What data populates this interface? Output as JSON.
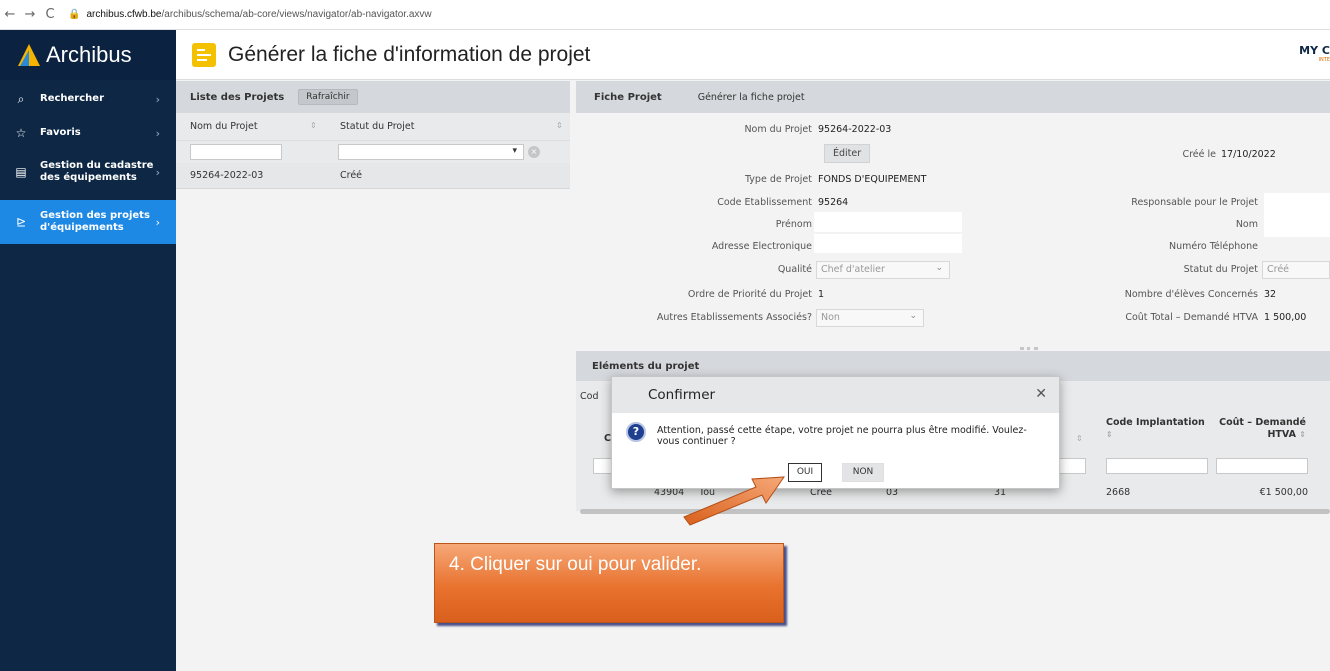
{
  "browser": {
    "back": "←",
    "forward": "→",
    "reload": "C",
    "url_host": "archibus.cfwb.be",
    "url_path": "/archibus/schema/ab-core/views/navigator/ab-navigator.axvw"
  },
  "app": {
    "logo": "Archibus"
  },
  "sidebar": {
    "items": [
      {
        "label": "Rechercher"
      },
      {
        "label": "Favoris"
      },
      {
        "label": "Gestion du cadastre des équipements"
      },
      {
        "label": "Gestion des projets d'équipements"
      }
    ]
  },
  "header": {
    "title": "Générer la fiche d'information de projet",
    "right": "MY C",
    "right_small": "INTE"
  },
  "list": {
    "title": "Liste des Projets",
    "refresh": "Rafraîchir",
    "columns": [
      "Nom du Projet",
      "Statut du Projet"
    ],
    "rows": [
      {
        "name": "95264-2022-03",
        "status": "Créé"
      }
    ]
  },
  "fiche": {
    "tab1": "Fiche Projet",
    "tab2": "Générer la fiche projet",
    "nom_projet_label": "Nom du Projet",
    "nom_projet": "95264-2022-03",
    "edit": "Éditer",
    "cree_le_label": "Créé le",
    "cree_le": "17/10/2022",
    "type_label": "Type de Projet",
    "type": "FONDS D'EQUIPEMENT",
    "code_etab_label": "Code Etablissement",
    "code_etab": "95264",
    "responsable_label": "Responsable pour le Projet",
    "prenom_label": "Prénom",
    "nom_label": "Nom",
    "email_label": "Adresse Electronique",
    "tel_label": "Numéro Téléphone",
    "qualite_label": "Qualité",
    "qualite": "Chef d'atelier",
    "statut_label": "Statut du Projet",
    "statut": "Créé",
    "priorite_label": "Ordre de Priorité du Projet",
    "priorite": "1",
    "eleves_label": "Nombre d'élèves Concernés",
    "eleves": "32",
    "autres_label": "Autres Etablissements Associés?",
    "autres": "Non",
    "cout_label": "Coût Total – Demandé HTVA",
    "cout": "1 500,00"
  },
  "elements": {
    "title": "Eléments du projet",
    "col_cod": "Cod",
    "col_c": "C",
    "col_code_impl": "Code Implantation",
    "col_cout": "Coût – Demandé HTVA",
    "row": {
      "id": "43904",
      "name": "Tou",
      "status": "Créé",
      "c3": "03",
      "c4": "31",
      "impl": "2668",
      "cout": "€1 500,00"
    }
  },
  "modal": {
    "title": "Confirmer",
    "message": "Attention, passé cette étape, votre projet ne pourra plus être modifié. Voulez-vous continuer ?",
    "yes": "OUI",
    "no": "NON"
  },
  "annotation": {
    "text": "4. Cliquer sur oui pour valider."
  },
  "colors": {
    "sidebar": "#0e2744",
    "active": "#1e88e5",
    "accent": "#f4c100",
    "callout": "#e8722e"
  },
  "icons": {
    "search": "search-icon",
    "star": "star-icon",
    "book": "book-icon",
    "project": "project-icon",
    "question": "question-icon",
    "close": "close-icon"
  }
}
